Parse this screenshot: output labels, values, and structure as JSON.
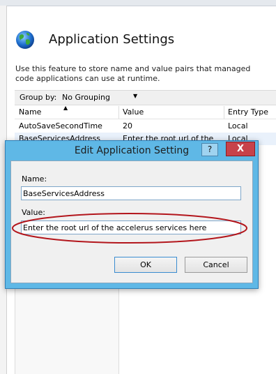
{
  "page": {
    "title": "Application Settings",
    "description": "Use this feature to store name and value pairs that managed code applications can use at runtime."
  },
  "groupby": {
    "label": "Group by:",
    "value": "No Grouping"
  },
  "table": {
    "columns": [
      "Name",
      "Value",
      "Entry Type"
    ],
    "rows": [
      {
        "name": "AutoSaveSecondTime",
        "value": "20",
        "type": "Local"
      },
      {
        "name": "BaseServicesAddress",
        "value": "Enter the root url of the",
        "type": "Local"
      }
    ]
  },
  "dialog": {
    "title": "Edit Application Setting",
    "help_label": "?",
    "close_label": "X",
    "name_label": "Name:",
    "name_value": "BaseServicesAddress",
    "value_label": "Value:",
    "value_value": "Enter the root url of the accelerus services here",
    "ok_label": "OK",
    "cancel_label": "Cancel"
  },
  "colors": {
    "dialog_frame": "#5fb8e6",
    "annotation": "#b3161c"
  },
  "icons": {
    "app": "globe-icon",
    "sort": "sort-ascending-icon",
    "dropdown": "chevron-down-icon"
  }
}
